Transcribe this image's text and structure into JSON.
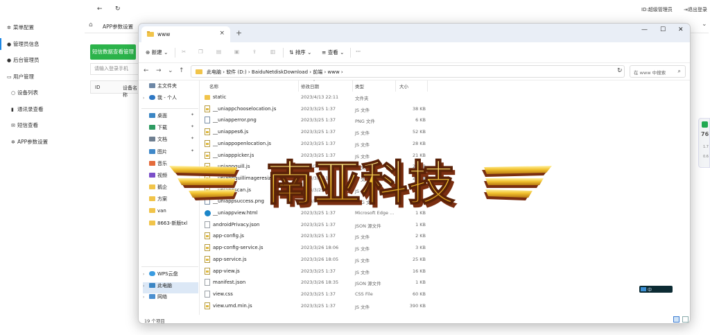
{
  "topbar": {
    "back_icon": "arrow-left-icon",
    "refresh_icon": "refresh-icon",
    "user_id": "ID:超级管理员",
    "logout": "退出登录"
  },
  "sidebar": {
    "items": [
      {
        "label": "菜单配置",
        "icon": "gear-icon"
      },
      {
        "label": "管理员信息",
        "icon": "user-icon"
      },
      {
        "label": "后台管理员",
        "icon": "user-icon"
      },
      {
        "label": "用户管理",
        "icon": "id-card-icon"
      },
      {
        "label": "设备列表",
        "icon": "user-outline-icon"
      },
      {
        "label": "通讯录查看",
        "icon": "book-icon"
      },
      {
        "label": "短信查看",
        "icon": "envelope-icon"
      },
      {
        "label": "APP参数设置",
        "icon": "gear-icon"
      }
    ]
  },
  "main": {
    "tab_label": "APP参数设置",
    "green_button": "短信数据查看管理",
    "search_placeholder": "请输入登录手机",
    "table_headers": [
      "ID",
      "设备名称"
    ]
  },
  "explorer": {
    "tab_title": "www",
    "toolbar": {
      "new": "新建",
      "sort": "排序",
      "view": "查看",
      "more": "···"
    },
    "breadcrumbs": "此电脑  ›  软件 (D:)  ›  BaiduNetdiskDownload  ›  前端  ›  www  ›",
    "search_placeholder": "在 www 中搜索",
    "nav": {
      "quick_access": "主文件夹",
      "personal": "我 - 个人",
      "pinned": [
        {
          "label": "桌面",
          "color": "#3b86c4"
        },
        {
          "label": "下载",
          "color": "#2e9b62"
        },
        {
          "label": "文档",
          "color": "#6f7f91"
        },
        {
          "label": "图片",
          "color": "#3f88c9"
        },
        {
          "label": "音乐",
          "color": "#e46b3c"
        },
        {
          "label": "视频",
          "color": "#7b4fc9"
        },
        {
          "label": "鹅企",
          "color": "#f1c44a"
        },
        {
          "label": "方案",
          "color": "#f1c44a"
        },
        {
          "label": "van",
          "color": "#f1c44a"
        },
        {
          "label": "8663-新版txl",
          "color": "#f1c44a"
        }
      ],
      "wps": "WPS云盘",
      "this_pc": "此电脑",
      "network": "网络"
    },
    "columns": {
      "name": "名称",
      "date": "修改日期",
      "type": "类型",
      "size": "大小"
    },
    "files": [
      {
        "name": "static",
        "date": "2023/4/13 22:11",
        "type": "文件夹",
        "size": "",
        "icon": "folder"
      },
      {
        "name": "__uniappchooselocation.js",
        "date": "2023/3/25 1:37",
        "type": "JS 文件",
        "size": "38 KB",
        "icon": "js"
      },
      {
        "name": "__uniapperror.png",
        "date": "2023/3/25 1:37",
        "type": "PNG 文件",
        "size": "6 KB",
        "icon": "png"
      },
      {
        "name": "__uniappes6.js",
        "date": "2023/3/25 1:37",
        "type": "JS 文件",
        "size": "52 KB",
        "icon": "js"
      },
      {
        "name": "__uniappopenlocation.js",
        "date": "2023/3/25 1:37",
        "type": "JS 文件",
        "size": "28 KB",
        "icon": "js"
      },
      {
        "name": "__uniapppicker.js",
        "date": "2023/3/25 1:37",
        "type": "JS 文件",
        "size": "21 KB",
        "icon": "js"
      },
      {
        "name": "__uniappquill.js",
        "date": "2023/3/25 1:37",
        "type": "JS 文件",
        "size": "21 KB",
        "icon": "js"
      },
      {
        "name": "__uniappquillimageresize.js",
        "date": "2023/3/25 1:37",
        "type": "JS 文件",
        "size": "24 KB",
        "icon": "js"
      },
      {
        "name": "__uniappscan.js",
        "date": "2023/3/25 1:37",
        "type": "JS 文件",
        "size": "",
        "icon": "js"
      },
      {
        "name": "__uniappsuccess.png",
        "date": "2023/3/25 1:37",
        "type": "PNG 文件",
        "size": "",
        "icon": "png"
      },
      {
        "name": "__uniappview.html",
        "date": "2023/3/25 1:37",
        "type": "Microsoft Edge ...",
        "size": "1 KB",
        "icon": "edge"
      },
      {
        "name": "androidPrivacy.json",
        "date": "2023/3/25 1:37",
        "type": "JSON 源文件",
        "size": "1 KB",
        "icon": "doc"
      },
      {
        "name": "app-config.js",
        "date": "2023/3/25 1:37",
        "type": "JS 文件",
        "size": "2 KB",
        "icon": "js"
      },
      {
        "name": "app-config-service.js",
        "date": "2023/3/26 18:06",
        "type": "JS 文件",
        "size": "3 KB",
        "icon": "js"
      },
      {
        "name": "app-service.js",
        "date": "2023/3/26 18:05",
        "type": "JS 文件",
        "size": "25 KB",
        "icon": "js"
      },
      {
        "name": "app-view.js",
        "date": "2023/3/25 1:37",
        "type": "JS 文件",
        "size": "16 KB",
        "icon": "js"
      },
      {
        "name": "manifest.json",
        "date": "2023/3/26 18:35",
        "type": "JSON 源文件",
        "size": "1 KB",
        "icon": "doc"
      },
      {
        "name": "view.css",
        "date": "2023/3/25 1:37",
        "type": "CSS File",
        "size": "60 KB",
        "icon": "doc"
      },
      {
        "name": "view.umd.min.js",
        "date": "2023/3/25 1:37",
        "type": "JS 文件",
        "size": "390 KB",
        "icon": "js"
      }
    ],
    "status": "19 个项目"
  },
  "overlay": {
    "logo_text": "南亚科技",
    "gold": "#f2c230",
    "shadow": "#8a3a12"
  },
  "widget": {
    "value": "76",
    "line1": "1.7",
    "line2": "0.6"
  },
  "floating_badge": "中"
}
